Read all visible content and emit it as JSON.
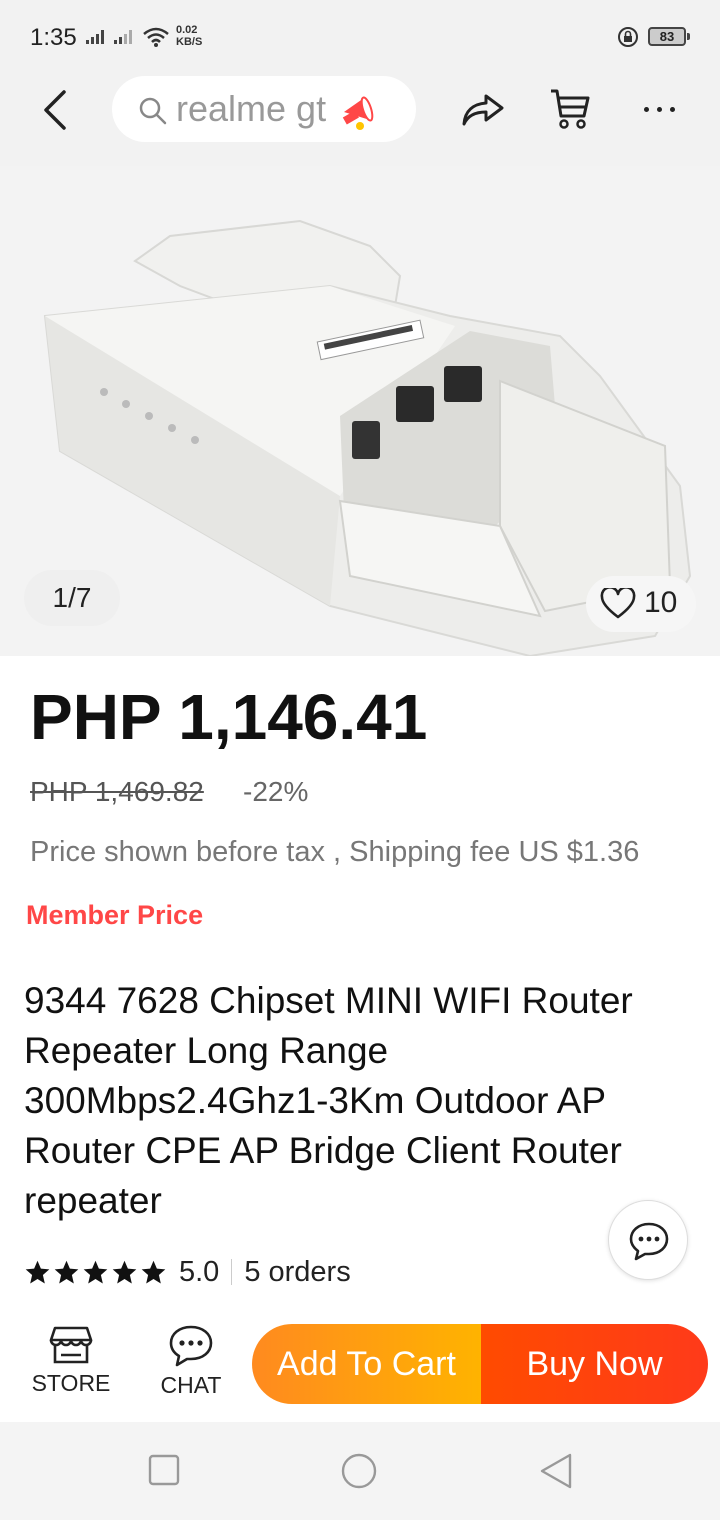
{
  "status_bar": {
    "time": "1:35",
    "net_speed_value": "0.02",
    "net_speed_unit": "KB/S",
    "battery": "83"
  },
  "top_nav": {
    "search_text": "realme gt"
  },
  "gallery": {
    "counter": "1/7",
    "wishlist_count": "10"
  },
  "product": {
    "price": "PHP 1,146.41",
    "original_price": "PHP 1,469.82",
    "discount": "-22%",
    "tax_note": "Price shown before tax , Shipping fee US $1.36",
    "member_price": "Member Price",
    "title": "9344 7628 Chipset MINI WIFI Router Repeater Long Range 300Mbps2.4Ghz1-3Km Outdoor AP Router CPE AP Bridge Client Router repeater",
    "rating": "5.0",
    "stars": 5,
    "orders": "5 orders"
  },
  "action_bar": {
    "store_label": "STORE",
    "chat_label": "CHAT",
    "add_to_cart_label": "Add To Cart",
    "buy_now_label": "Buy Now"
  },
  "colors": {
    "member_price": "#ff4747",
    "add_to_cart": "#ffa000",
    "buy_now": "#ff4400"
  },
  "icons": [
    "back-icon",
    "search-icon",
    "megaphone-icon",
    "share-icon",
    "cart-icon",
    "more-icon",
    "heart-icon",
    "star-icon",
    "chat-bubble-icon",
    "store-icon",
    "chat-icon",
    "recents-icon",
    "home-icon",
    "back-nav-icon"
  ]
}
